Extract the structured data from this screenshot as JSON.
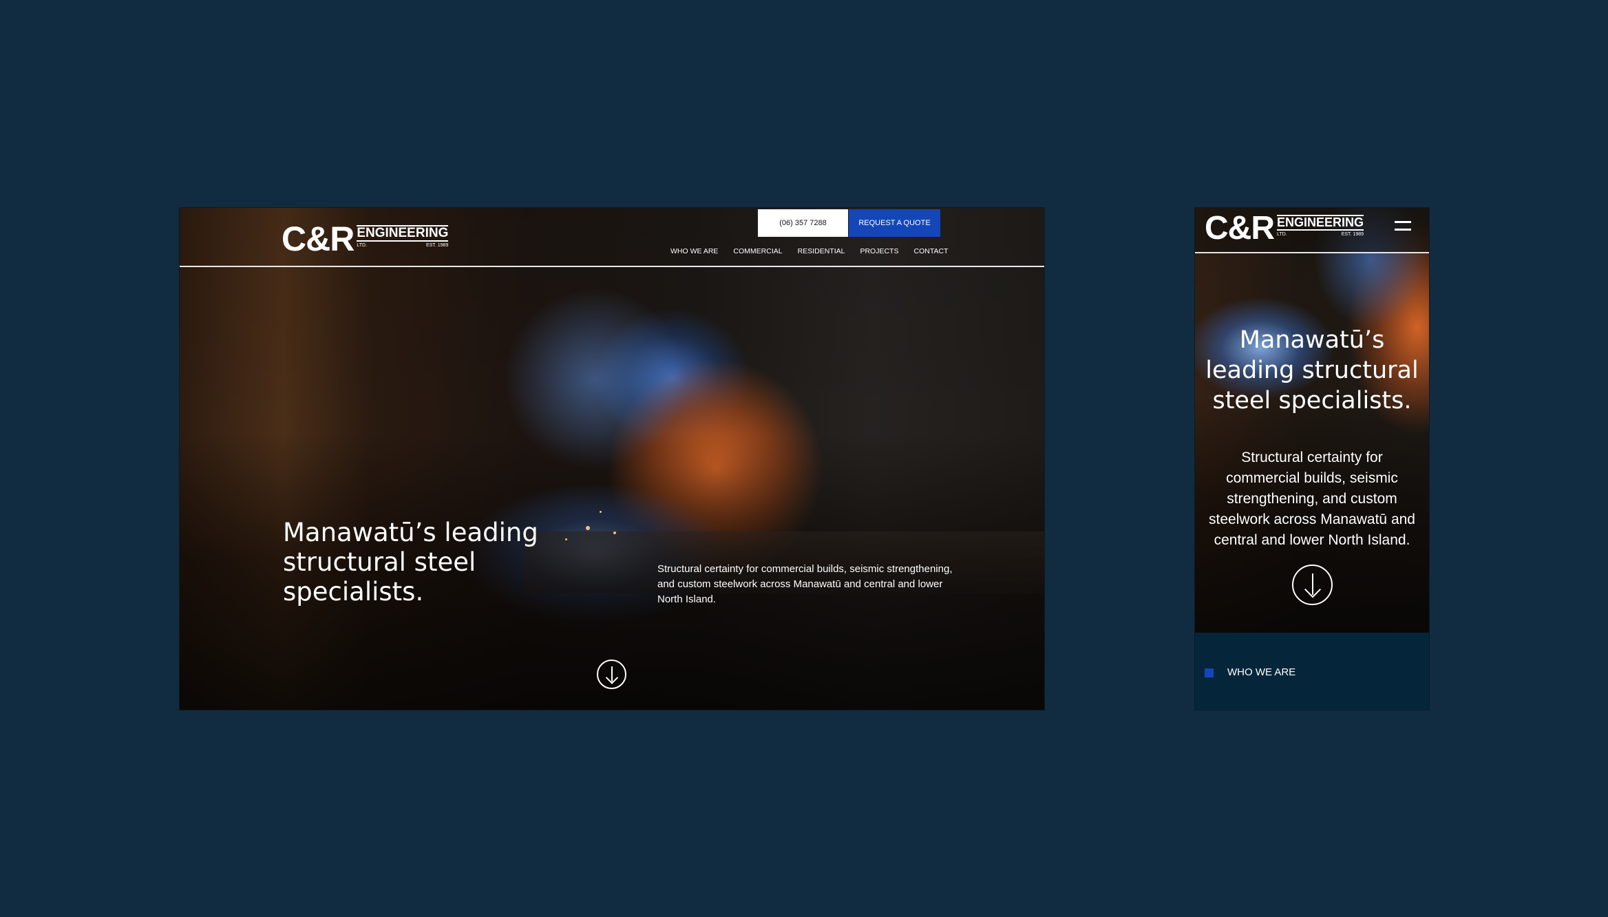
{
  "brand": {
    "mark": "C&R",
    "word": "ENGINEERING",
    "sub_left": "LTD.",
    "sub_right": "EST. 1989"
  },
  "desktop": {
    "phone": "(06) 357 7288",
    "quote": "REQUEST A QUOTE",
    "nav": [
      "WHO WE ARE",
      "COMMERCIAL",
      "RESIDENTIAL",
      "PROJECTS",
      "CONTACT"
    ],
    "hero_title": "Manawatū’s leading structural steel specialists.",
    "hero_sub": "Structural certainty for commercial builds, seismic strengthening, and custom steelwork across Manawatū and central and lower North Island."
  },
  "mobile": {
    "hero_title": "Manawatū’s leading structural steel specialists.",
    "hero_sub": "Structural certainty for commercial builds, seismic strengthening, and custom steelwork across Manawatū and central and lower North Island.",
    "section_label": "WHO WE ARE"
  },
  "colors": {
    "background": "#112c40",
    "accent_blue": "#1546b8",
    "mobile_panel": "#05263a"
  },
  "icons": [
    "scroll-down-arrow-icon",
    "hamburger-menu-icon"
  ]
}
